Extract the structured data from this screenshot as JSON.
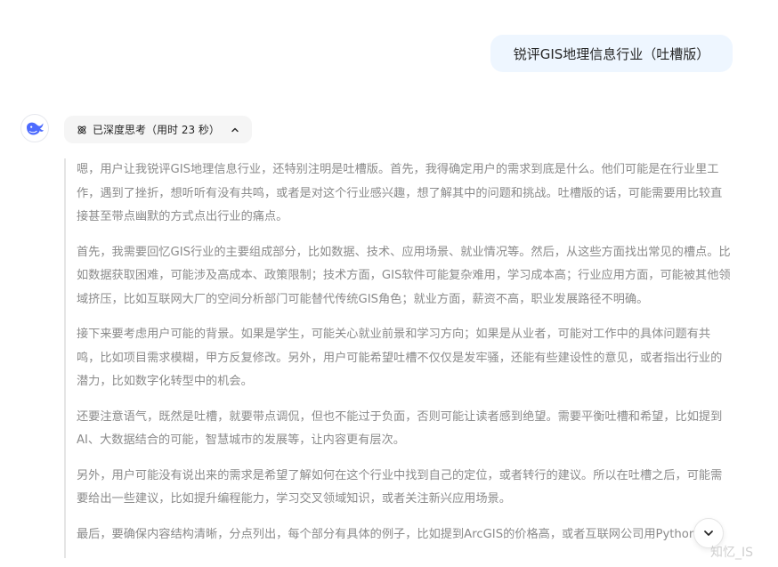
{
  "user_message": "锐评GIS地理信息行业（吐槽版）",
  "thinking_chip": {
    "label": "已深度思考（用时 23 秒）"
  },
  "thought_paragraphs": [
    "嗯，用户让我锐评GIS地理信息行业，还特别注明是吐槽版。首先，我得确定用户的需求到底是什么。他们可能是在行业里工作，遇到了挫折，想听听有没有共鸣，或者是对这个行业感兴趣，想了解其中的问题和挑战。吐槽版的话，可能需要用比较直接甚至带点幽默的方式点出行业的痛点。",
    "首先，我需要回忆GIS行业的主要组成部分，比如数据、技术、应用场景、就业情况等。然后，从这些方面找出常见的槽点。比如数据获取困难，可能涉及高成本、政策限制；技术方面，GIS软件可能复杂难用，学习成本高；行业应用方面，可能被其他领域挤压，比如互联网大厂的空间分析部门可能替代传统GIS角色；就业方面，薪资不高，职业发展路径不明确。",
    "接下来要考虑用户可能的背景。如果是学生，可能关心就业前景和学习方向；如果是从业者，可能对工作中的具体问题有共鸣，比如项目需求模糊，甲方反复修改。另外，用户可能希望吐槽不仅仅是发牢骚，还能有些建设性的意见，或者指出行业的潜力，比如数字化转型中的机会。",
    "还要注意语气，既然是吐槽，就要带点调侃，但也不能过于负面，否则可能让读者感到绝望。需要平衡吐槽和希望，比如提到AI、大数据结合的可能，智慧城市的发展等，让内容更有层次。",
    "另外，用户可能没有说出来的需求是希望了解如何在这个行业中找到自己的定位，或者转行的建议。所以在吐槽之后，可能需要给出一些建议，比如提升编程能力，学习交叉领域知识，或者关注新兴应用场景。",
    "最后，要确保内容结构清晰，分点列出，每个部分有具体的例子，比如提到ArcGIS的价格高，或者互联网公司用Python"
  ],
  "watermark": "知忆_IS",
  "icons": {
    "avatar": "deepseek-whale-logo",
    "chip_icon": "atom-icon",
    "chip_toggle": "chevron-up-icon",
    "scroll": "chevron-down-icon"
  },
  "colors": {
    "user_bubble_bg": "#eef6ff",
    "brand_blue": "#4d6bfe",
    "thought_text": "#8b8b8b"
  }
}
